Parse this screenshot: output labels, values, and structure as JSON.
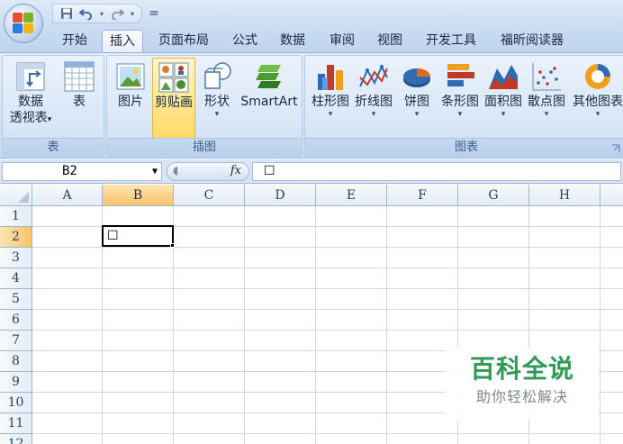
{
  "quick_access": {
    "icons": [
      "save-icon",
      "undo-icon",
      "redo-icon",
      "customize-qat-icon"
    ],
    "customize_glyph": "="
  },
  "tabs": [
    {
      "label": "开始",
      "active": false
    },
    {
      "label": "插入",
      "active": true
    },
    {
      "label": "页面布局",
      "active": false
    },
    {
      "label": "公式",
      "active": false
    },
    {
      "label": "数据",
      "active": false
    },
    {
      "label": "审阅",
      "active": false
    },
    {
      "label": "视图",
      "active": false
    },
    {
      "label": "开发工具",
      "active": false
    },
    {
      "label": "福昕阅读器",
      "active": false
    }
  ],
  "ribbon": {
    "groups": {
      "table": {
        "label": "表",
        "buttons": {
          "pivot": {
            "line1": "数据",
            "line2": "透视表",
            "has_dropdown": true
          },
          "table": {
            "label": "表"
          }
        }
      },
      "illustrations": {
        "label": "插图",
        "buttons": {
          "picture": {
            "label": "图片"
          },
          "clipart": {
            "label": "剪贴画",
            "selected": true
          },
          "shapes": {
            "label": "形状",
            "has_dropdown": true
          },
          "smartart": {
            "label": "SmartArt"
          }
        }
      },
      "charts": {
        "label": "图表",
        "buttons": {
          "column": {
            "label": "柱形图",
            "has_dropdown": true
          },
          "line": {
            "label": "折线图",
            "has_dropdown": true
          },
          "pie": {
            "label": "饼图",
            "has_dropdown": true
          },
          "bar": {
            "label": "条形图",
            "has_dropdown": true
          },
          "area": {
            "label": "面积图",
            "has_dropdown": true
          },
          "scatter": {
            "label": "散点图",
            "has_dropdown": true
          },
          "other": {
            "label": "其他图表",
            "has_dropdown": true
          }
        }
      }
    },
    "dropdown_glyph": "▾"
  },
  "formula_bar": {
    "name_box": "B2",
    "fx_label": "fx",
    "formula_value": "☐"
  },
  "sheet": {
    "columns": [
      "A",
      "B",
      "C",
      "D",
      "E",
      "F",
      "G",
      "H"
    ],
    "rows": [
      "1",
      "2",
      "3",
      "4",
      "5",
      "6",
      "7",
      "8",
      "9",
      "10",
      "11",
      "12"
    ],
    "selected_column": "B",
    "selected_row": "2",
    "active_cell": {
      "ref": "B2",
      "value": "☐"
    }
  },
  "watermark": {
    "title": "百科全说",
    "subtitle": "助你轻松解决"
  },
  "colors": {
    "accent_green": "#2f9b57",
    "ribbon_blue": "#c6d9f1",
    "selected_header": "#f9c36b"
  }
}
